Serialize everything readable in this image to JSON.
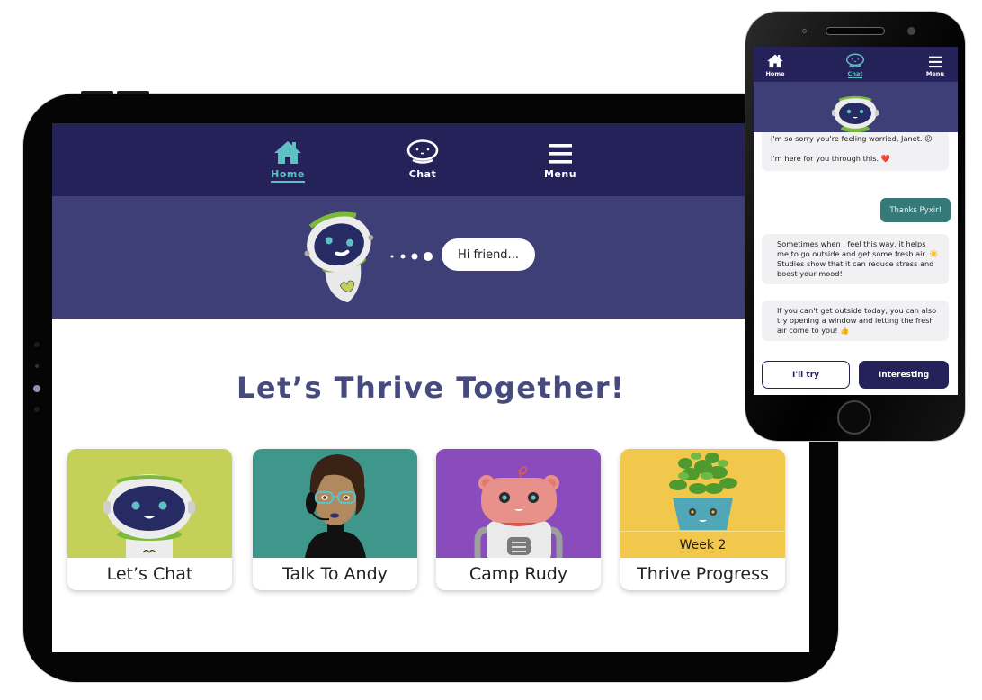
{
  "colors": {
    "nav_bg": "#252159",
    "hero_bg": "#3f3f78",
    "accent_teal": "#5fc0c4",
    "title_color": "#464a7f",
    "user_bubble": "#357a78",
    "bot_bubble": "#f1f1f4",
    "card_lets_chat": "#c4d057",
    "card_talk_to_andy": "#3f968a",
    "card_camp_rudy": "#8a4bbd",
    "card_thrive_progress": "#f1c84b"
  },
  "tablet": {
    "nav": {
      "items": [
        {
          "label": "Home",
          "icon": "home-icon",
          "active": true
        },
        {
          "label": "Chat",
          "icon": "robot-chat-icon",
          "active": false
        },
        {
          "label": "Menu",
          "icon": "hamburger-menu-icon",
          "active": false
        }
      ]
    },
    "hero": {
      "greeting": "Hi friend..."
    },
    "title": "Let’s Thrive Together!",
    "cards": [
      {
        "label": "Let’s Chat",
        "art": "robot-pyxir"
      },
      {
        "label": "Talk To Andy",
        "art": "andy-avatar"
      },
      {
        "label": "Camp Rudy",
        "art": "rudy-bear-robot"
      },
      {
        "label": "Thrive Progress",
        "art": "plant-pot",
        "badge": "Week 2"
      }
    ]
  },
  "phone": {
    "nav": {
      "items": [
        {
          "label": "Home",
          "icon": "home-icon",
          "active": false
        },
        {
          "label": "Chat",
          "icon": "robot-chat-icon",
          "active": true
        },
        {
          "label": "Menu",
          "icon": "hamburger-menu-icon",
          "active": false
        }
      ]
    },
    "messages": [
      {
        "from": "bot",
        "lines": [
          "I'm so sorry you're feeling worried, Janet. 😕",
          "I'm here for you through this. ❤️"
        ]
      },
      {
        "from": "user",
        "text": "Thanks Pyxir!"
      },
      {
        "from": "bot",
        "text": "Sometimes when I feel this way, it helps me to go outside and get some fresh air. ☀️ Studies show that it can reduce stress and boost your mood!"
      },
      {
        "from": "bot",
        "text": "If you can't get outside today, you can also try opening a window and letting the fresh air come to you! 👍"
      }
    ],
    "quick_replies": [
      "I'll try",
      "Interesting"
    ]
  }
}
